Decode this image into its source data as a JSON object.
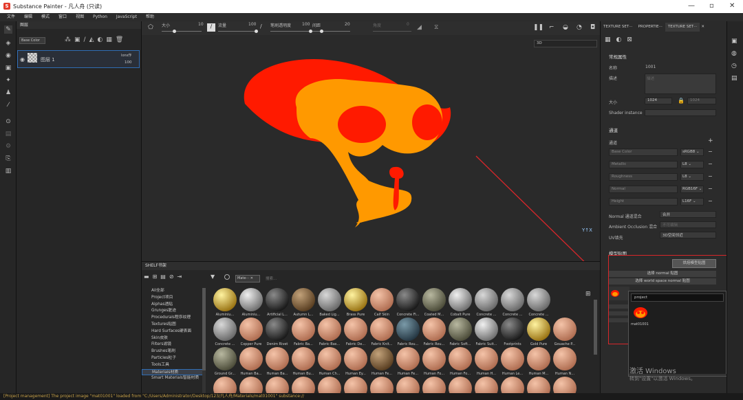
{
  "app": {
    "title": "Substance Painter - 凡人舟 (只读)"
  },
  "menu": [
    "文件",
    "编辑",
    "模式",
    "窗口",
    "视图",
    "Python",
    "JavaScript",
    "帮助"
  ],
  "layers": {
    "title": "图层",
    "channel": "Base Color",
    "layer_name": "图层 1",
    "blend": "Ions作",
    "opacity": "100"
  },
  "viewport": {
    "size_label": "大小",
    "size_val": "10",
    "flow_label": "流量",
    "flow_val": "100",
    "stroke_label": "笔刷透明度",
    "stroke_val": "100",
    "spacing_label": "间距",
    "spacing_val": "20",
    "angle_label": "角度",
    "angle_val": "0",
    "view_mode": "3D"
  },
  "shelf": {
    "title": "SHELF书架",
    "filter_tag": "Mate···",
    "search_placeholder": "搜索...",
    "categories": [
      "All全部",
      "Project项目",
      "Alphas透贴",
      "Grunges脏迹",
      "Procedurals程序纹理",
      "Textures贴图",
      "Hard Surfaces硬表面",
      "Skin皮肤",
      "Filters滤镜",
      "Brushes笔刷",
      "Particles粒子",
      "Tools工具",
      "Materials材质",
      "Smart Materials智能材质"
    ],
    "selected_category": "Materials材质",
    "row1": [
      "Aluminiu...",
      "Aluminiu...",
      "Artificial L...",
      "Autumn L...",
      "Baked Lig...",
      "Brass Pure",
      "Calf Skin",
      "Concrete Fi...",
      "Coated M...",
      "Cobalt Pure",
      "Concrete ...",
      "Concrete ...",
      "Concrete ..."
    ],
    "row2": [
      "Concrete ...",
      "Copper Pure",
      "Denim Rivet",
      "Fabric Ba...",
      "Fabric Bas...",
      "Fabric De...",
      "Fabric Knit...",
      "Fabric Rou...",
      "Fabric Rou...",
      "Fabric Soft...",
      "Fabric Suit...",
      "Footprints",
      "Gold Pure",
      "Gouache P..."
    ],
    "row3": [
      "Ground Gr...",
      "Human Ba...",
      "Human Ba...",
      "Human Bu...",
      "Human Ch...",
      "Human Ey...",
      "Human Fe...",
      "Human Fe...",
      "Human Fo...",
      "Human Fo...",
      "Human H...",
      "Human Le...",
      "Human M...",
      "Human N..."
    ]
  },
  "tabs": [
    "TEXTURE SET···",
    "PROPERTIE···",
    "TEXTURE SET···"
  ],
  "props": {
    "section_basic": "常规属性",
    "name_label": "名称",
    "name_val": "1001",
    "desc_label": "描述",
    "desc_placeholder": "描述",
    "size_label": "大小",
    "size_val": "1024",
    "size_val2": "1024",
    "shader_label": "Shader instance",
    "section_channels": "通道",
    "channels_label": "通道",
    "channels": [
      {
        "name": "Base Color",
        "fmt": "sRGB8"
      },
      {
        "name": "Metallic",
        "fmt": "L8"
      },
      {
        "name": "Roughness",
        "fmt": "L8"
      },
      {
        "name": "Normal",
        "fmt": "RGB16F"
      },
      {
        "name": "Height",
        "fmt": "L16F"
      }
    ],
    "normal_label": "Normal 通道混合",
    "normal_val": "合并",
    "ao_label": "Ambient Occlusion 混合",
    "ao_placeholder": "不可编辑",
    "uv_label": "UV填充",
    "uv_val": "3D空间邻近",
    "section_maps": "模型贴图",
    "bake_btn": "烘焙模型贴图",
    "select_normal": "选择 normal 贴图",
    "select_ws": "选择 world space normal 贴图"
  },
  "popup": {
    "search_val": "project",
    "item_label": "mat01001"
  },
  "watermark": {
    "line1": "激活 Windows",
    "line2": "转到\"设置\"以激活 Windows。"
  },
  "status": "[Project management] The project image \"mat01001\" loaded from \"C:/Users/Administrator/Desktop/123/凡人舟/Materials/mat01001\" substance://",
  "colors": {
    "accent": "#2f6db5",
    "red": "#ff1a00",
    "orange": "#ff9900",
    "annotation": "#d9262a"
  }
}
